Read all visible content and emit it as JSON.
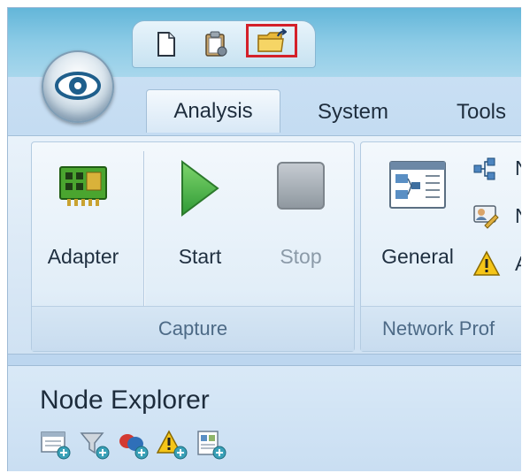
{
  "tabs": [
    {
      "label": "Analysis",
      "active": true
    },
    {
      "label": "System",
      "active": false
    },
    {
      "label": "Tools",
      "active": false
    }
  ],
  "quick_access": [
    {
      "icon": "new-document-icon"
    },
    {
      "icon": "clipboard-icon"
    },
    {
      "icon": "open-folder-icon",
      "highlighted": true
    }
  ],
  "ribbon": {
    "capture_group": {
      "label": "Capture",
      "buttons": [
        {
          "label": "Adapter",
          "icon": "network-adapter-icon",
          "enabled": true
        },
        {
          "label": "Start",
          "icon": "play-icon",
          "enabled": true
        },
        {
          "label": "Stop",
          "icon": "stop-icon",
          "enabled": false
        }
      ]
    },
    "network_group": {
      "label": "Network Prof",
      "buttons": [
        {
          "label": "General",
          "icon": "network-profile-icon",
          "enabled": true
        }
      ],
      "small_items": [
        {
          "label": "N",
          "icon": "network-nodes-icon"
        },
        {
          "label": "N",
          "icon": "user-card-icon"
        },
        {
          "label": "A",
          "icon": "warning-icon"
        }
      ]
    }
  },
  "node_explorer": {
    "title": "Node Explorer",
    "toolbar": [
      {
        "icon": "add-window-icon"
      },
      {
        "icon": "add-filter-icon"
      },
      {
        "icon": "add-group-icon"
      },
      {
        "icon": "add-alert-icon"
      },
      {
        "icon": "add-report-icon"
      }
    ]
  },
  "colors": {
    "highlight": "#d4202a",
    "title_bar": "#63b6d9",
    "ribbon": "#dbe9f6",
    "start_green": "#3aa63f"
  }
}
